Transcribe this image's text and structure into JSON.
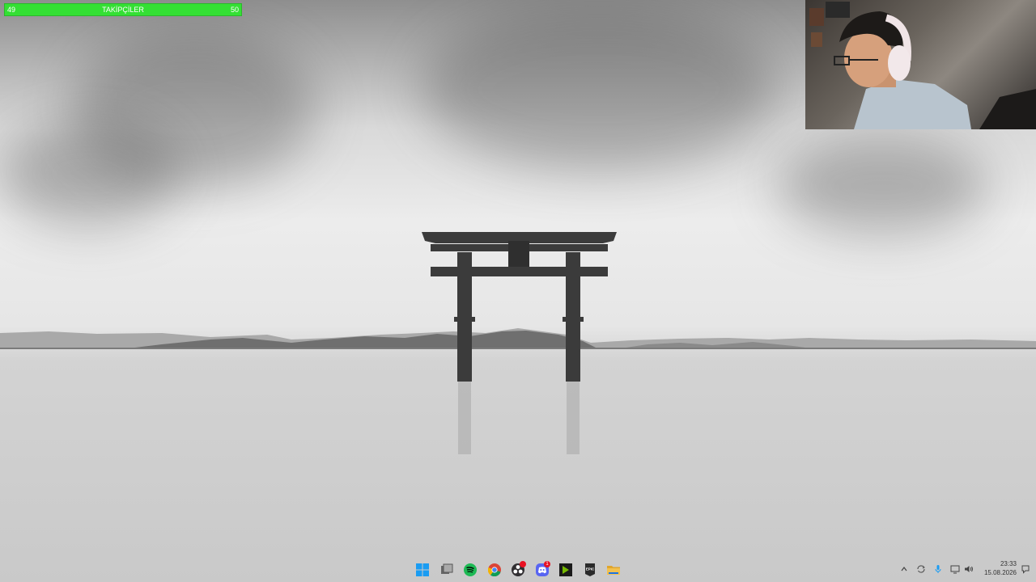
{
  "goal_bar": {
    "title": "TAKİPÇİLER",
    "current": "49",
    "target": "50"
  },
  "taskbar": {
    "apps": [
      {
        "name": "start-button",
        "icon": "windows-logo-icon"
      },
      {
        "name": "task-view-button",
        "icon": "task-view-icon"
      },
      {
        "name": "spotify-button",
        "icon": "spotify-icon"
      },
      {
        "name": "chrome-button",
        "icon": "chrome-icon"
      },
      {
        "name": "obs-button",
        "icon": "obs-icon"
      },
      {
        "name": "discord-button",
        "icon": "discord-icon",
        "badge": "1"
      },
      {
        "name": "nvidia-button",
        "icon": "nvidia-icon"
      },
      {
        "name": "epic-games-button",
        "icon": "epic-games-icon",
        "label": "EPIC"
      },
      {
        "name": "file-explorer-button",
        "icon": "folder-icon"
      }
    ],
    "tray": [
      "chevron-up-icon",
      "sync-icon",
      "microphone-icon",
      "network-icon",
      "volume-icon"
    ]
  },
  "clock": {
    "time": "23:33",
    "date": "15.08.2026"
  },
  "colors": {
    "goal_bar": "#34e034",
    "spotify": "#1db954",
    "discord": "#5865f2",
    "nvidia": "#76b900",
    "epic": "#2a2a2a",
    "folder": "#f2c14e"
  }
}
